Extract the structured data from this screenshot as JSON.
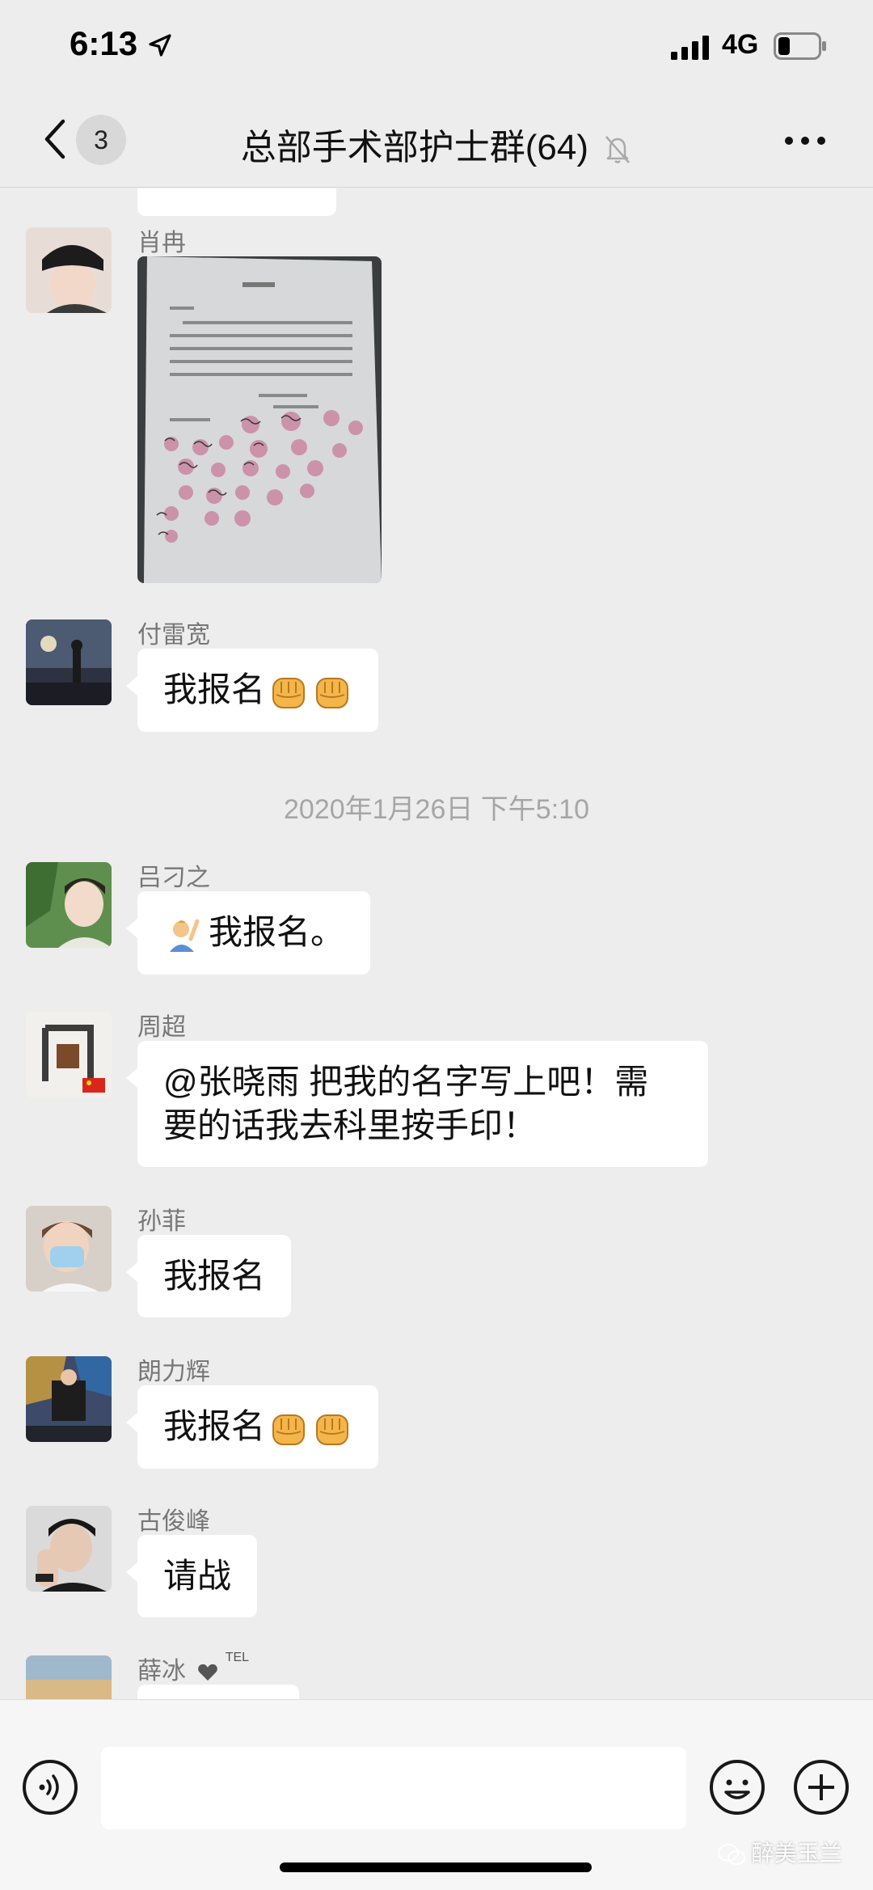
{
  "status_bar": {
    "time": "6:13",
    "network": "4G"
  },
  "header": {
    "unread_count": "3",
    "title": "总部手术部护士群(64)"
  },
  "messages": [
    {
      "sender": "肖冉",
      "type": "image"
    },
    {
      "sender": "付雷宽",
      "text": "我报名"
    },
    {
      "sender": "吕刁之",
      "text": "我报名。"
    },
    {
      "sender": "周超",
      "line1": "@张晓雨 把我的名字写上吧！需",
      "line2": "要的话我去科里按手印！"
    },
    {
      "sender": "孙菲",
      "text": "我报名"
    },
    {
      "sender": "朗力辉",
      "text": "我报名"
    },
    {
      "sender": "古俊峰",
      "text": "请战"
    },
    {
      "sender": "薛冰",
      "tag": "TEL"
    }
  ],
  "timestamp": "2020年1月26日 下午5:10",
  "input": {
    "placeholder": ""
  },
  "watermark": "醉美玉兰",
  "colors": {
    "background": "#ededed",
    "bubble": "#ffffff",
    "timestamp": "#a6a6a6"
  }
}
